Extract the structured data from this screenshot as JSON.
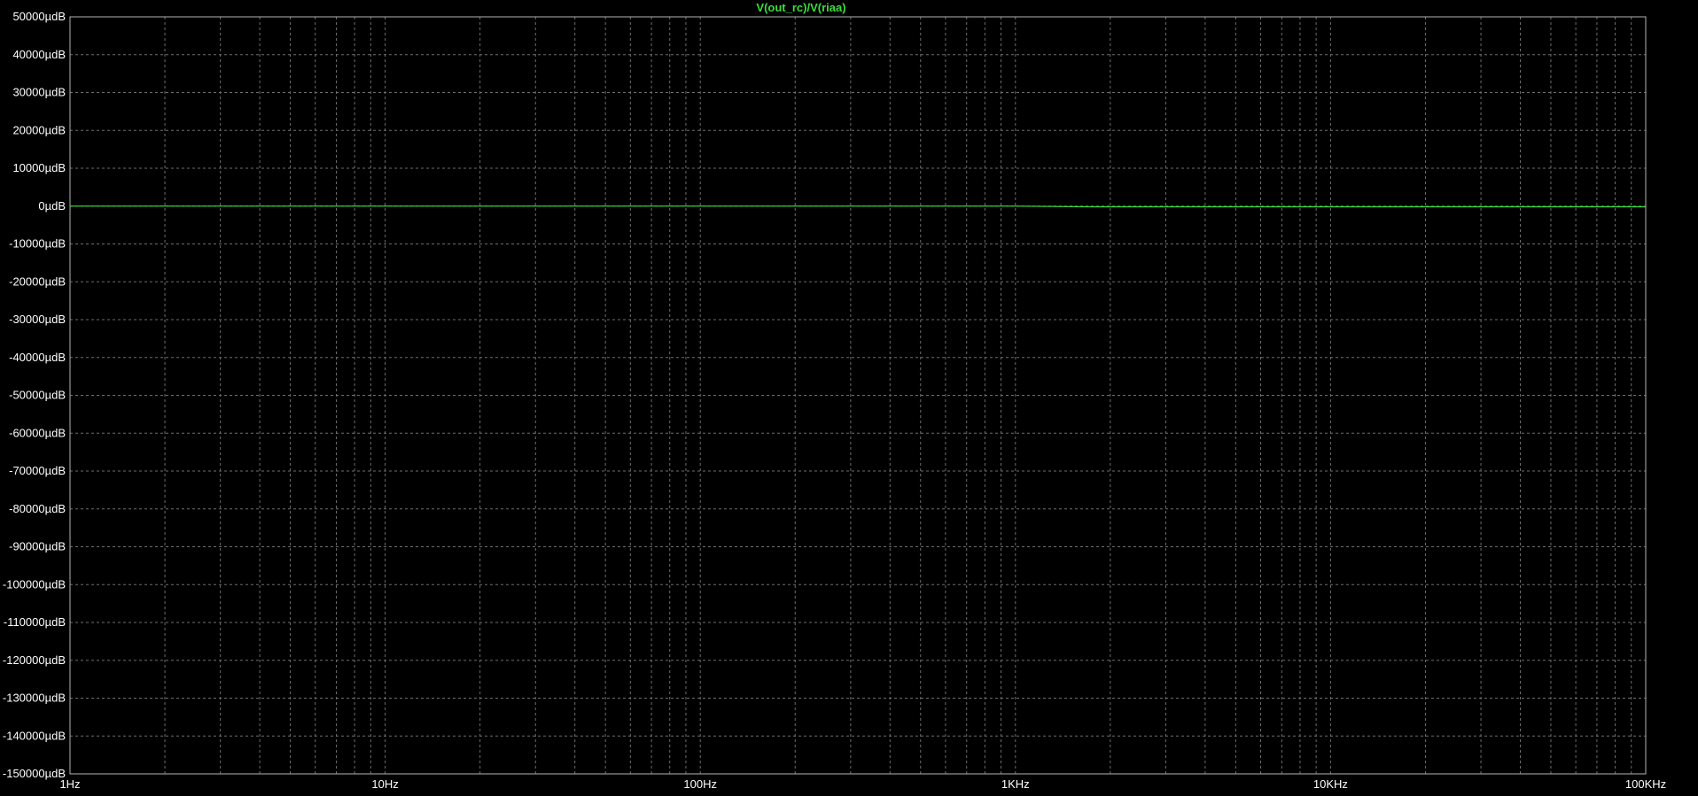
{
  "chart_data": {
    "type": "line",
    "title": "V(out_rc)/V(riaa)",
    "x_scale": "log",
    "xlim": [
      1,
      100000
    ],
    "ylim": [
      -150000,
      50000
    ],
    "y_unit": "µdB",
    "grid": true,
    "x_ticks": [
      {
        "value": 1,
        "label": "1Hz"
      },
      {
        "value": 10,
        "label": "10Hz"
      },
      {
        "value": 100,
        "label": "100Hz"
      },
      {
        "value": 1000,
        "label": "1KHz"
      },
      {
        "value": 10000,
        "label": "10KHz"
      },
      {
        "value": 100000,
        "label": "100KHz"
      }
    ],
    "y_ticks": [
      {
        "value": 50000,
        "label": "50000µdB"
      },
      {
        "value": 40000,
        "label": "40000µdB"
      },
      {
        "value": 30000,
        "label": "30000µdB"
      },
      {
        "value": 20000,
        "label": "20000µdB"
      },
      {
        "value": 10000,
        "label": "10000µdB"
      },
      {
        "value": 0,
        "label": "0µdB"
      },
      {
        "value": -10000,
        "label": "-10000µdB"
      },
      {
        "value": -20000,
        "label": "-20000µdB"
      },
      {
        "value": -30000,
        "label": "-30000µdB"
      },
      {
        "value": -40000,
        "label": "-40000µdB"
      },
      {
        "value": -50000,
        "label": "-50000µdB"
      },
      {
        "value": -60000,
        "label": "-60000µdB"
      },
      {
        "value": -70000,
        "label": "-70000µdB"
      },
      {
        "value": -80000,
        "label": "-80000µdB"
      },
      {
        "value": -90000,
        "label": "-90000µdB"
      },
      {
        "value": -100000,
        "label": "-100000µdB"
      },
      {
        "value": -110000,
        "label": "-110000µdB"
      },
      {
        "value": -120000,
        "label": "-120000µdB"
      },
      {
        "value": -130000,
        "label": "-130000µdB"
      },
      {
        "value": -140000,
        "label": "-140000µdB"
      },
      {
        "value": -150000,
        "label": "-150000µdB"
      }
    ],
    "series": [
      {
        "name": "V(out_rc)/V(riaa)",
        "color": "#3cdc3c",
        "x": [
          1,
          10,
          100,
          1000,
          1800,
          10000,
          100000
        ],
        "y": [
          0,
          0,
          0,
          0,
          -200,
          -200,
          -200
        ]
      }
    ]
  },
  "colors": {
    "background": "#000000",
    "grid": "#6e6e6e",
    "frame": "#b4b4b4",
    "text": "#ffffff"
  }
}
